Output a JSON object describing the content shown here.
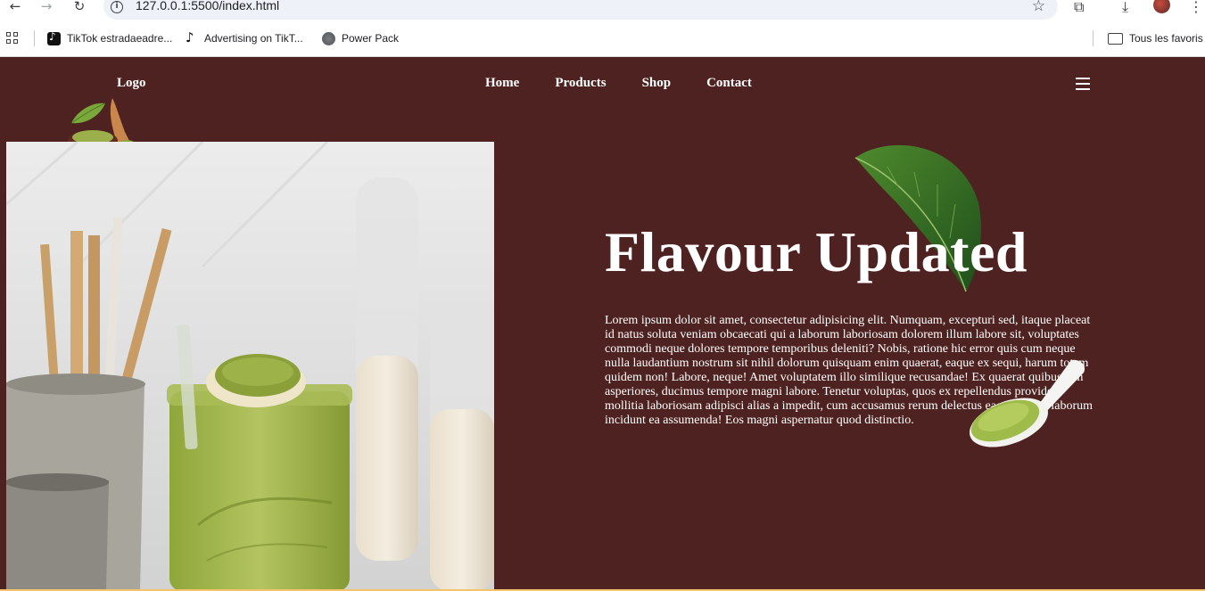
{
  "browser": {
    "url": "127.0.0.1:5500/index.html",
    "bookmarks": [
      {
        "label": "TikTok estradaeadre...",
        "icon": "tiktok-icon"
      },
      {
        "label": "Advertising on TikT...",
        "icon": "tiktok-icon"
      },
      {
        "label": "Power Pack",
        "icon": "globe-icon"
      }
    ],
    "all_bookmarks_label": "Tous les favoris"
  },
  "site": {
    "logo": "Logo",
    "nav": [
      "Home",
      "Products",
      "Shop",
      "Contact"
    ],
    "hero": {
      "title": "Flavour Updated",
      "body": "Lorem ipsum dolor sit amet, consectetur adipisicing elit. Numquam, excepturi sed, itaque placeat id natus soluta veniam obcaecati qui a laborum laboriosam dolorem illum labore sit, voluptates commodi neque dolores tempore temporibus deleniti? Nobis, ratione hic error quis cum neque nulla laudantium nostrum sit nihil dolorum quisquam enim quaerat, eaque ex sequi, harum totam quidem non! Labore, neque! Amet voluptatem illo similique recusandae! Ex quaerat quibusdam asperiores, ducimus tempore magni labore. Tenetur voluptas, quos ex repellendus provident mollitia laboriosam adipisci alias a impedit, cum accusamus rerum delectus eaque facilis laborum incidunt ea assumenda! Eos magni aspernatur quod distinctio."
    }
  },
  "colors": {
    "page_bg": "#4e2220",
    "accent_line": "#f5c46a",
    "matcha": "#8fa63b"
  }
}
